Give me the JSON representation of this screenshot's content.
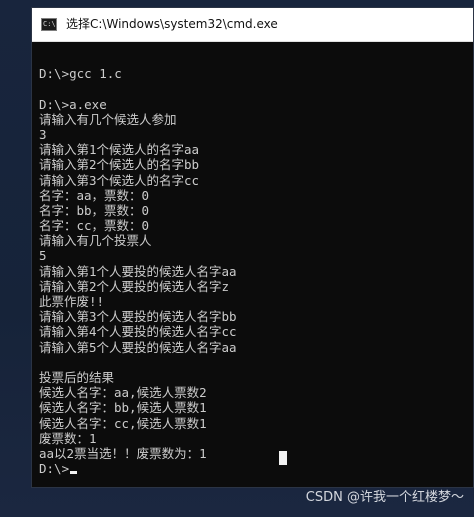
{
  "window": {
    "icon_text": "C:\\",
    "title": "选择C:\\Windows\\system32\\cmd.exe"
  },
  "console": {
    "lines": [
      "",
      "D:\\>gcc 1.c",
      "",
      "D:\\>a.exe",
      "请输入有几个候选人参加",
      "3",
      "请输入第1个候选人的名字aa",
      "请输入第2个候选人的名字bb",
      "请输入第3个候选人的名字cc",
      "名字：aa，票数：0",
      "名字：bb，票数：0",
      "名字：cc，票数：0",
      "请输入有几个投票人",
      "5",
      "请输入第1个人要投的候选人名字aa",
      "请输入第2个人要投的候选人名字z",
      "此票作废!!",
      "请输入第3个人要投的候选人名字bb",
      "请输入第4个人要投的候选人名字cc",
      "请输入第5个人要投的候选人名字aa",
      "",
      "投票后的结果",
      "候选人名字：aa,候选人票数2",
      "候选人名字：bb,候选人票数1",
      "候选人名字：cc,候选人票数1",
      "废票数：1",
      "aa以2票当选！！废票数为：1",
      "D:\\>"
    ]
  },
  "watermark": {
    "text": "CSDN @许我一个红楼梦～"
  }
}
